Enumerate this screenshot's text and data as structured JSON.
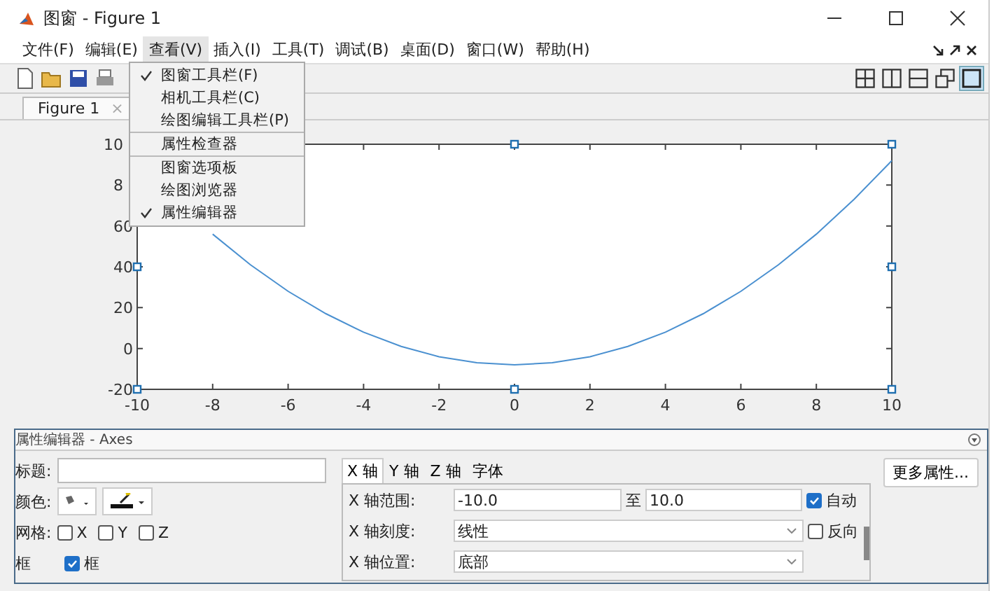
{
  "window": {
    "title": "图窗 - Figure 1"
  },
  "menu_bar": [
    {
      "label": "文件(F)",
      "selected": false
    },
    {
      "label": "编辑(E)",
      "selected": false
    },
    {
      "label": "查看(V)",
      "selected": true
    },
    {
      "label": "插入(I)",
      "selected": false
    },
    {
      "label": "工具(T)",
      "selected": false
    },
    {
      "label": "调试(B)",
      "selected": false
    },
    {
      "label": "桌面(D)",
      "selected": false
    },
    {
      "label": "窗口(W)",
      "selected": false
    },
    {
      "label": "帮助(H)",
      "selected": false
    }
  ],
  "view_menu": {
    "groups": [
      [
        {
          "label": "图窗工具栏(F)",
          "checked": true
        },
        {
          "label": "相机工具栏(C)",
          "checked": false
        },
        {
          "label": "绘图编辑工具栏(P)",
          "checked": false
        }
      ],
      [
        {
          "label": "属性检查器",
          "checked": false
        }
      ],
      [
        {
          "label": "图窗选项板",
          "checked": false
        },
        {
          "label": "绘图浏览器",
          "checked": false
        },
        {
          "label": "属性编辑器",
          "checked": true
        }
      ]
    ]
  },
  "figure_tab": {
    "label": "Figure 1",
    "close": "×"
  },
  "chart_data": {
    "type": "line",
    "x": [
      -8,
      -7,
      -6,
      -5,
      -4,
      -3,
      -2,
      -1,
      0,
      1,
      2,
      3,
      4,
      5,
      6,
      7,
      8,
      9,
      10
    ],
    "series": [
      {
        "color": "#4a90d0",
        "values": [
          56,
          41,
          28,
          17,
          8,
          1,
          -4,
          -7,
          -8,
          -7,
          -4,
          1,
          8,
          17,
          28,
          41,
          56,
          73,
          92
        ]
      }
    ],
    "xlim": [
      -10,
      10
    ],
    "ylim": [
      -20,
      100
    ],
    "xticks": [
      -10,
      -8,
      -6,
      -4,
      -2,
      0,
      2,
      4,
      6,
      8,
      10
    ],
    "yticks": [
      -20,
      0,
      20,
      40,
      60
    ]
  },
  "covered_y_labels": [
    "10",
    "8"
  ],
  "property_editor": {
    "title": "属性编辑器 - Axes",
    "title_label": "标题:",
    "color_label": "颜色:",
    "grid_label": "网格:",
    "grid": [
      {
        "label": "X",
        "checked": false
      },
      {
        "label": "Y",
        "checked": false
      },
      {
        "label": "Z",
        "checked": false
      }
    ],
    "box_label": "框",
    "box": {
      "label": "框",
      "checked": true
    },
    "tabs": [
      {
        "label": "X 轴",
        "selected": true
      },
      {
        "label": "Y 轴",
        "selected": false
      },
      {
        "label": "Z 轴",
        "selected": false
      },
      {
        "label": "字体",
        "selected": false
      }
    ],
    "range": {
      "label": "X 轴范围:",
      "from": "-10.0",
      "to_label": "至",
      "to": "10.0",
      "auto": {
        "label": "自动",
        "checked": true
      }
    },
    "scale": {
      "label": "X 轴刻度:",
      "value": "线性",
      "reverse": {
        "label": "反向",
        "checked": false
      }
    },
    "location": {
      "label": "X 轴位置:",
      "value": "底部"
    },
    "more_button": "更多属性..."
  }
}
